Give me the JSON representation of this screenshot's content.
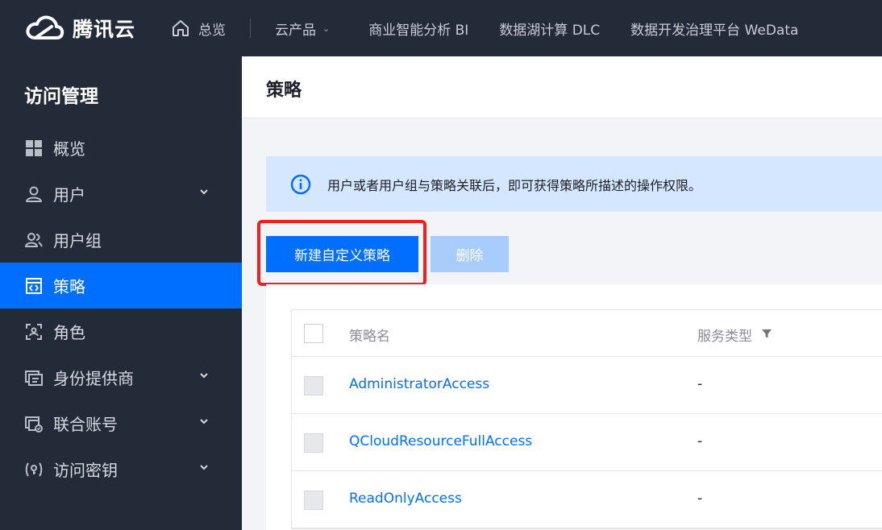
{
  "topbar": {
    "brand": "腾讯云",
    "home_label": "总览",
    "products_label": "云产品",
    "links": [
      "商业智能分析 BI",
      "数据湖计算 DLC",
      "数据开发治理平台 WeData"
    ]
  },
  "sidebar": {
    "title": "访问管理",
    "items": [
      {
        "label": "概览",
        "icon": "grid-icon",
        "has_chevron": false,
        "active": false
      },
      {
        "label": "用户",
        "icon": "user-icon",
        "has_chevron": true,
        "active": false
      },
      {
        "label": "用户组",
        "icon": "user-group-icon",
        "has_chevron": false,
        "active": false
      },
      {
        "label": "策略",
        "icon": "policy-icon",
        "has_chevron": false,
        "active": true
      },
      {
        "label": "角色",
        "icon": "role-icon",
        "has_chevron": false,
        "active": false
      },
      {
        "label": "身份提供商",
        "icon": "identity-provider-icon",
        "has_chevron": true,
        "active": false
      },
      {
        "label": "联合账号",
        "icon": "federated-account-icon",
        "has_chevron": true,
        "active": false
      },
      {
        "label": "访问密钥",
        "icon": "key-icon",
        "has_chevron": true,
        "active": false
      }
    ]
  },
  "main": {
    "title": "策略",
    "alert_text": "用户或者用户组与策略关联后，即可获得策略所描述的操作权限。",
    "create_button": "新建自定义策略",
    "delete_button": "删除",
    "table": {
      "columns": [
        "策略名",
        "服务类型"
      ],
      "rows": [
        {
          "name": "AdministratorAccess",
          "service": "-"
        },
        {
          "name": "QCloudResourceFullAccess",
          "service": "-"
        },
        {
          "name": "ReadOnlyAccess",
          "service": "-"
        }
      ]
    }
  },
  "colors": {
    "nav_bg": "#232b39",
    "accent": "#006eff",
    "alert_bg": "#d5e7ff",
    "highlight": "#f0201c"
  }
}
